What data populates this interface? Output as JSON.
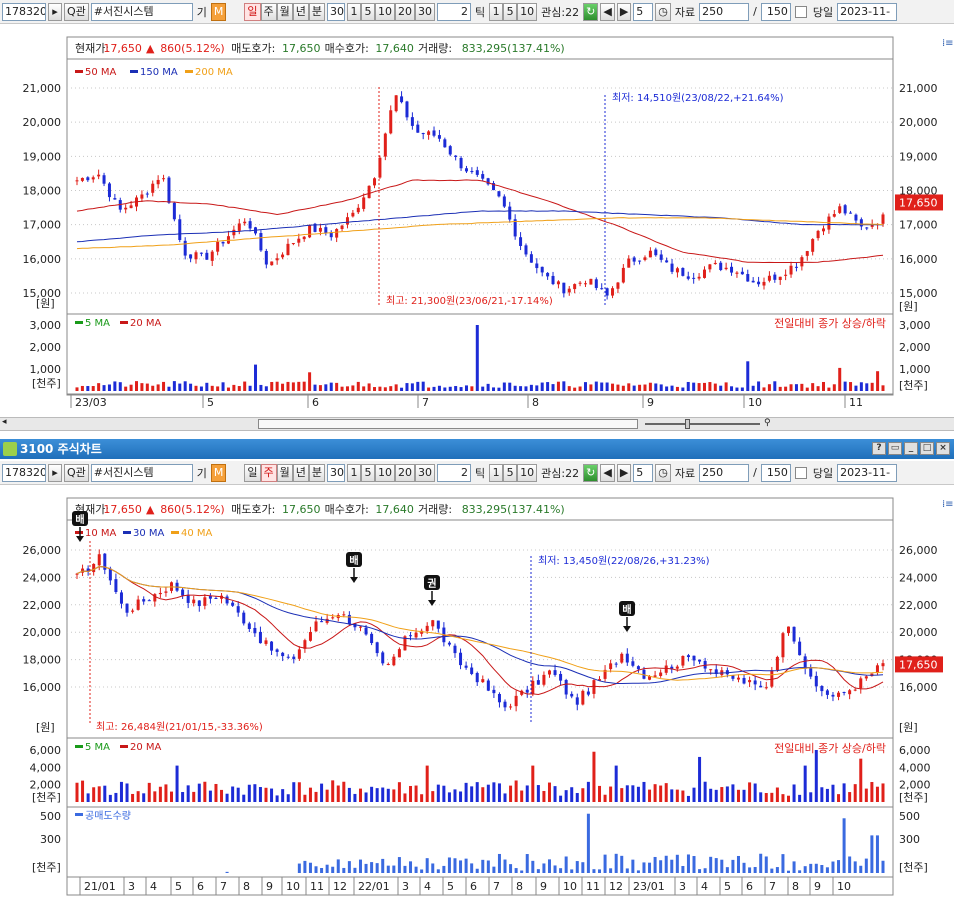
{
  "colors": {
    "up": "#e0201a",
    "down": "#1c2bd6",
    "ma_red": "#c81818",
    "ma_blue": "#1b2fb5",
    "ma_orange": "#f0a018",
    "green": "#1a9a1a",
    "bg": "#ffffff",
    "grid": "#c8c8c8",
    "title_bg": "#2b7bc6"
  },
  "top": {
    "toolbar": {
      "code": "178320",
      "search_icon": "Q",
      "search_label": "관",
      "name": "#서진시스템",
      "badge": "기",
      "badge2": "M",
      "periods": [
        "일",
        "주",
        "월",
        "년",
        "분"
      ],
      "sel_period": "일",
      "interval": "30s",
      "mins": [
        "1",
        "5",
        "10",
        "20",
        "30"
      ],
      "tick_val": "2",
      "tick_label": "틱",
      "ticks": [
        "1",
        "5",
        "10"
      ],
      "interest": "관심:22",
      "page": "5",
      "data_label": "자료",
      "count": "250",
      "slash": "/",
      "total": "150",
      "today": "당일",
      "date": "2023-11-"
    },
    "quote": {
      "cur_l": "현재가:",
      "cur": "17,650",
      "chg_arrow": "▲",
      "chg": "860(5.12%)",
      "ask_l": "매도호가:",
      "ask": "17,650",
      "bid_l": "매수호가:",
      "bid": "17,640",
      "vol_l": "거래량:",
      "vol": "833,295(137.41%)"
    },
    "legend": [
      "50 MA",
      "150 MA",
      "200 MA"
    ],
    "yticks": [
      "21,000",
      "20,000",
      "19,000",
      "18,000",
      "17,000",
      "16,000",
      "15,000"
    ],
    "unit": "[원]",
    "price_badge": "17,650",
    "ann_low": "최저: 14,510원(23/08/22,+21.64%)",
    "ann_high": "최고: 21,300원(23/06/21,-17.14%)",
    "vol_legend": [
      "5 MA",
      "20 MA"
    ],
    "vol_note": "전일대비 종가 상승/하락",
    "vol_yticks": [
      "3,000",
      "2,000",
      "1,000"
    ],
    "vol_unit": "[천주]",
    "xlabels": [
      "23/03",
      "5",
      "6",
      "7",
      "8",
      "9",
      "10",
      "11"
    ]
  },
  "bottom": {
    "title": "3100 주식차트",
    "toolbar": {
      "code": "178320",
      "search_icon": "Q",
      "search_label": "관",
      "name": "#서진시스템",
      "badge": "기",
      "badge2": "M",
      "periods": [
        "일",
        "주",
        "월",
        "년",
        "분"
      ],
      "sel_period": "주",
      "interval": "30s",
      "mins": [
        "1",
        "5",
        "10",
        "20",
        "30"
      ],
      "tick_val": "2",
      "tick_label": "틱",
      "ticks": [
        "1",
        "5",
        "10"
      ],
      "interest": "관심:22",
      "page": "5",
      "data_label": "자료",
      "count": "250",
      "slash": "/",
      "total": "150",
      "today": "당일",
      "date": "2023-11-"
    },
    "quote": {
      "cur_l": "현재가:",
      "cur": "17,650",
      "chg_arrow": "▲",
      "chg": "860(5.12%)",
      "ask_l": "매도호가:",
      "ask": "17,650",
      "bid_l": "매수호가:",
      "bid": "17,640",
      "vol_l": "거래량:",
      "vol": "833,295(137.41%)"
    },
    "legend": [
      "10 MA",
      "30 MA",
      "40 MA"
    ],
    "yticks": [
      "26,000",
      "24,000",
      "22,000",
      "20,000",
      "18,000",
      "16,000"
    ],
    "unit": "[원]",
    "price_badge": "17,650",
    "ann_low": "최저: 13,450원(22/08/26,+31.23%)",
    "ann_high": "최고: 26,484원(21/01/15,-33.36%)",
    "markers": [
      "배",
      "배",
      "권",
      "배"
    ],
    "vol_legend": [
      "5 MA",
      "20 MA"
    ],
    "vol_note": "전일대비 종가 상승/하락",
    "vol_yticks": [
      "6,000",
      "4,000",
      "2,000"
    ],
    "vol_unit": "[천주]",
    "short_legend": "공매도수량",
    "short_yticks": [
      "500",
      "300"
    ],
    "short_unit": "[천주]",
    "xlabels": [
      "21/01",
      "3",
      "4",
      "5",
      "6",
      "7",
      "8",
      "9",
      "10",
      "11",
      "12",
      "22/01",
      "3",
      "4",
      "5",
      "6",
      "7",
      "8",
      "9",
      "10",
      "11",
      "12",
      "23/01",
      "3",
      "4",
      "5",
      "6",
      "7",
      "8",
      "9",
      "10"
    ]
  }
}
